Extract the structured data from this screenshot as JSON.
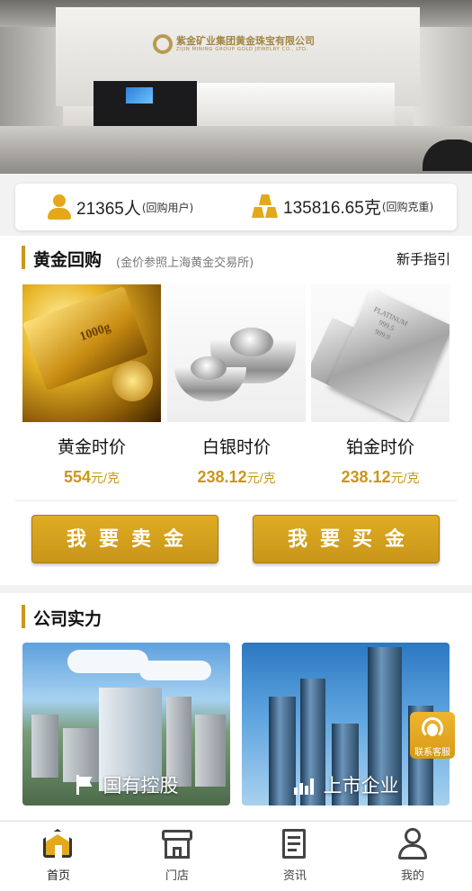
{
  "banner": {
    "company_name_cn": "紫金矿业集团黄金珠宝有限公司",
    "company_name_en": "ZIJIN MINING GROUP GOLD JEWELRY CO., LTD."
  },
  "stats": {
    "users_value": "21365人",
    "users_label": "(回购用户)",
    "weight_value": "135816.65克",
    "weight_label": "(回购克重)"
  },
  "gold_buyback": {
    "title": "黄金回购",
    "subtitle": "(金价参照上海黄金交易所)",
    "guide_link": "新手指引",
    "products": [
      {
        "name": "黄金时价",
        "price": "554",
        "unit": "元/克",
        "image": "gold-bars"
      },
      {
        "name": "白银时价",
        "price": "238.12",
        "unit": "元/克",
        "image": "silver-ingots"
      },
      {
        "name": "铂金时价",
        "price": "238.12",
        "unit": "元/克",
        "image": "platinum-bar"
      }
    ],
    "sell_button": "我要卖金",
    "buy_button": "我要买金"
  },
  "company": {
    "title": "公司实力",
    "cards": [
      {
        "label": "国有控股",
        "icon": "flag-icon"
      },
      {
        "label": "上市企业",
        "icon": "chart-icon"
      }
    ],
    "service_button": "联系客服"
  },
  "tabbar": {
    "tabs": [
      {
        "label": "首页",
        "icon": "home-icon",
        "active": true
      },
      {
        "label": "门店",
        "icon": "store-icon",
        "active": false
      },
      {
        "label": "资讯",
        "icon": "news-icon",
        "active": false
      },
      {
        "label": "我的",
        "icon": "user-icon",
        "active": false
      }
    ]
  },
  "colors": {
    "accent": "#c9971c",
    "button": "#d9a51f"
  }
}
